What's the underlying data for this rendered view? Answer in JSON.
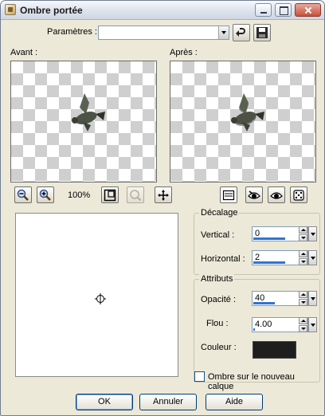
{
  "window": {
    "title": "Ombre portée"
  },
  "params": {
    "label": "Paramètres :",
    "value": ""
  },
  "preview": {
    "before_label": "Avant :",
    "after_label": "Après :"
  },
  "zoom": {
    "value": "100%"
  },
  "offset": {
    "title": "Décalage",
    "vertical_label": "Vertical :",
    "vertical_value": "0",
    "vertical_fraction": 0.6,
    "horizontal_label": "Horizontal :",
    "horizontal_value": "2",
    "horizontal_fraction": 0.6
  },
  "attributes": {
    "title": "Attributs",
    "opacity_label": "Opacité :",
    "opacity_value": "40",
    "opacity_fraction": 0.4,
    "blur_label": "Flou :",
    "blur_value": "4.00",
    "blur_fraction": 0.03,
    "color_label": "Couleur :",
    "color_value": "#1e1e1e"
  },
  "options": {
    "new_layer_label": "Ombre sur le nouveau calque",
    "new_layer_checked": false
  },
  "buttons": {
    "ok": "OK",
    "cancel": "Annuler",
    "help": "Aide"
  },
  "icons": [
    "app-icon",
    "reset-icon",
    "save-icon",
    "zoom-out-icon",
    "zoom-in-icon",
    "fit-icon",
    "zoom-reset-icon",
    "pan-icon",
    "selection-icon",
    "eye-icon",
    "dice-icon",
    "crosshair-icon",
    "bird-icon"
  ]
}
